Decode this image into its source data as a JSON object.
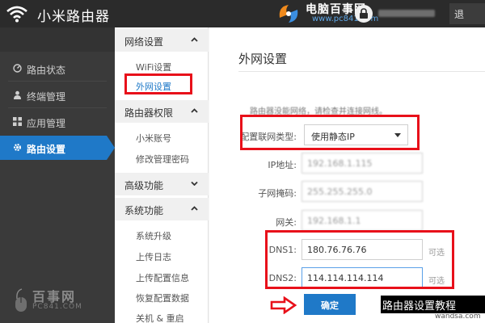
{
  "header": {
    "app_title": "小米路由器",
    "watermark_title": "电脑百事网",
    "watermark_url": "www.pc841.com",
    "logout_label": "退"
  },
  "sidebar": {
    "items": [
      {
        "label": "路由状态",
        "icon": "gauge-icon",
        "active": false
      },
      {
        "label": "终端管理",
        "icon": "user-icon",
        "active": false
      },
      {
        "label": "应用管理",
        "icon": "grid-icon",
        "active": false
      },
      {
        "label": "路由设置",
        "icon": "gear-icon",
        "active": true
      }
    ],
    "brand_name": "百事网",
    "brand_url": "PC841.COM"
  },
  "submenu": {
    "groups": [
      {
        "label": "网络设置",
        "items": [
          "WiFi设置",
          "外网设置"
        ]
      },
      {
        "label": "路由器权限",
        "items": [
          "小米账号",
          "修改管理密码"
        ]
      },
      {
        "label": "高级功能",
        "items": []
      },
      {
        "label": "系统功能",
        "items": [
          "系统升级",
          "上传日志",
          "上传配置信息",
          "恢复配置数据",
          "关机 & 重启"
        ]
      }
    ],
    "active_item": "外网设置"
  },
  "main": {
    "title": "外网设置",
    "notice": "路由器没能网络，请检查并连接网线。",
    "form": {
      "conn_type_label": "配置联网类型:",
      "conn_type_value": "使用静态IP",
      "ip_label": "IP地址:",
      "ip_value": "192.168.1.115",
      "mask_label": "子网掩码:",
      "mask_value": "255.255.255.0",
      "gateway_label": "网关:",
      "gateway_value": "192.168.1.1",
      "dns1_label": "DNS1:",
      "dns1_value": "180.76.76.76",
      "dns2_label": "DNS2:",
      "dns2_value": "114.114.114.114",
      "optional_label": "可选"
    },
    "ok_label": "确定"
  },
  "caption": {
    "text": "路由器设置教程",
    "site": "wandsa.com"
  },
  "colors": {
    "accent": "#1f79c8",
    "highlight": "#e8101a",
    "header_bg": "#2b2b2b",
    "sidebar_bg": "#3a3a3a"
  }
}
